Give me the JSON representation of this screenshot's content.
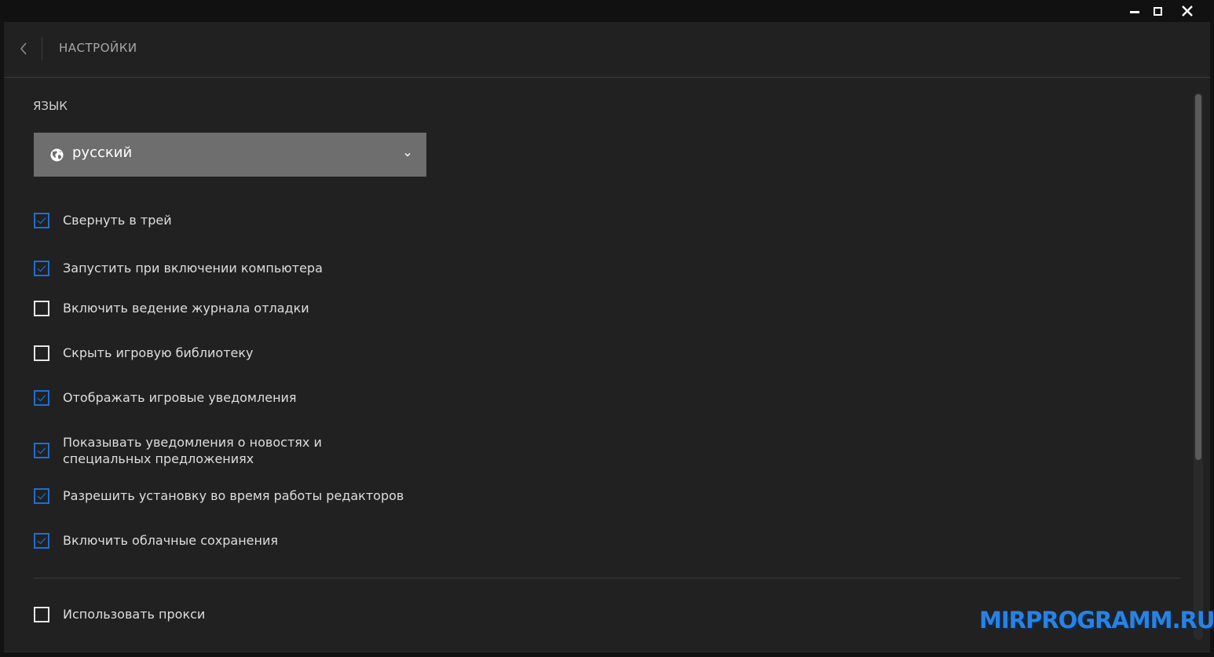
{
  "window": {
    "controls": [
      "minimize-icon",
      "maximize-icon",
      "close-icon"
    ]
  },
  "header": {
    "title": "НАСТРОЙКИ",
    "back_icon": "chevron-left-icon"
  },
  "language": {
    "label": "ЯЗЫК",
    "selected": "русский",
    "icon": "globe-icon"
  },
  "options": [
    {
      "label": "Свернуть в трей",
      "checked": true
    },
    {
      "label": "Запустить при включении компьютера",
      "checked": true
    },
    {
      "label": "Включить ведение журнала отладки",
      "checked": false
    },
    {
      "label": "Скрыть игровую библиотеку",
      "checked": false
    },
    {
      "label": "Отображать игровые уведомления",
      "checked": true
    },
    {
      "label": "Показывать уведомления о новостях и специальных предложениях",
      "checked": true
    },
    {
      "label": "Разрешить установку во время работы редакторов",
      "checked": true
    },
    {
      "label": "Включить облачные сохранения",
      "checked": true
    }
  ],
  "proxy": {
    "label": "Использовать прокси",
    "checked": false
  },
  "watermark": "MIRPROGRAMM.RU",
  "colors": {
    "accent": "#1e6fd0",
    "background": "#212121",
    "select_bg": "#6e6e6e"
  }
}
